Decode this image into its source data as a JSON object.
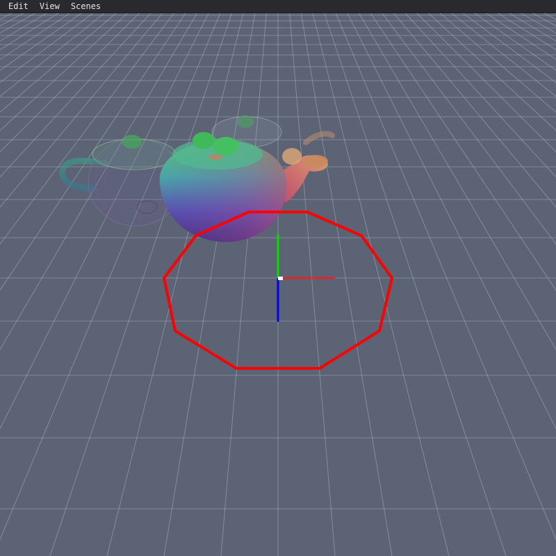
{
  "menubar": {
    "items": [
      {
        "label": "Edit"
      },
      {
        "label": "View"
      },
      {
        "label": "Scenes"
      }
    ]
  },
  "viewport": {
    "background_color": "#5b6374",
    "grid_color": "#aab0bd",
    "gizmo": {
      "x_axis_color": "#ff1a1a",
      "y_axis_color": "#00e000",
      "z_axis_color": "#0000ee"
    },
    "selection_ring_color": "#ff0000",
    "objects": [
      {
        "name": "teapot-solid",
        "shading": "normals"
      },
      {
        "name": "teapot-transparent",
        "shading": "normals-transparent"
      },
      {
        "name": "teapot-wireframe",
        "shading": "wireframe"
      }
    ]
  }
}
